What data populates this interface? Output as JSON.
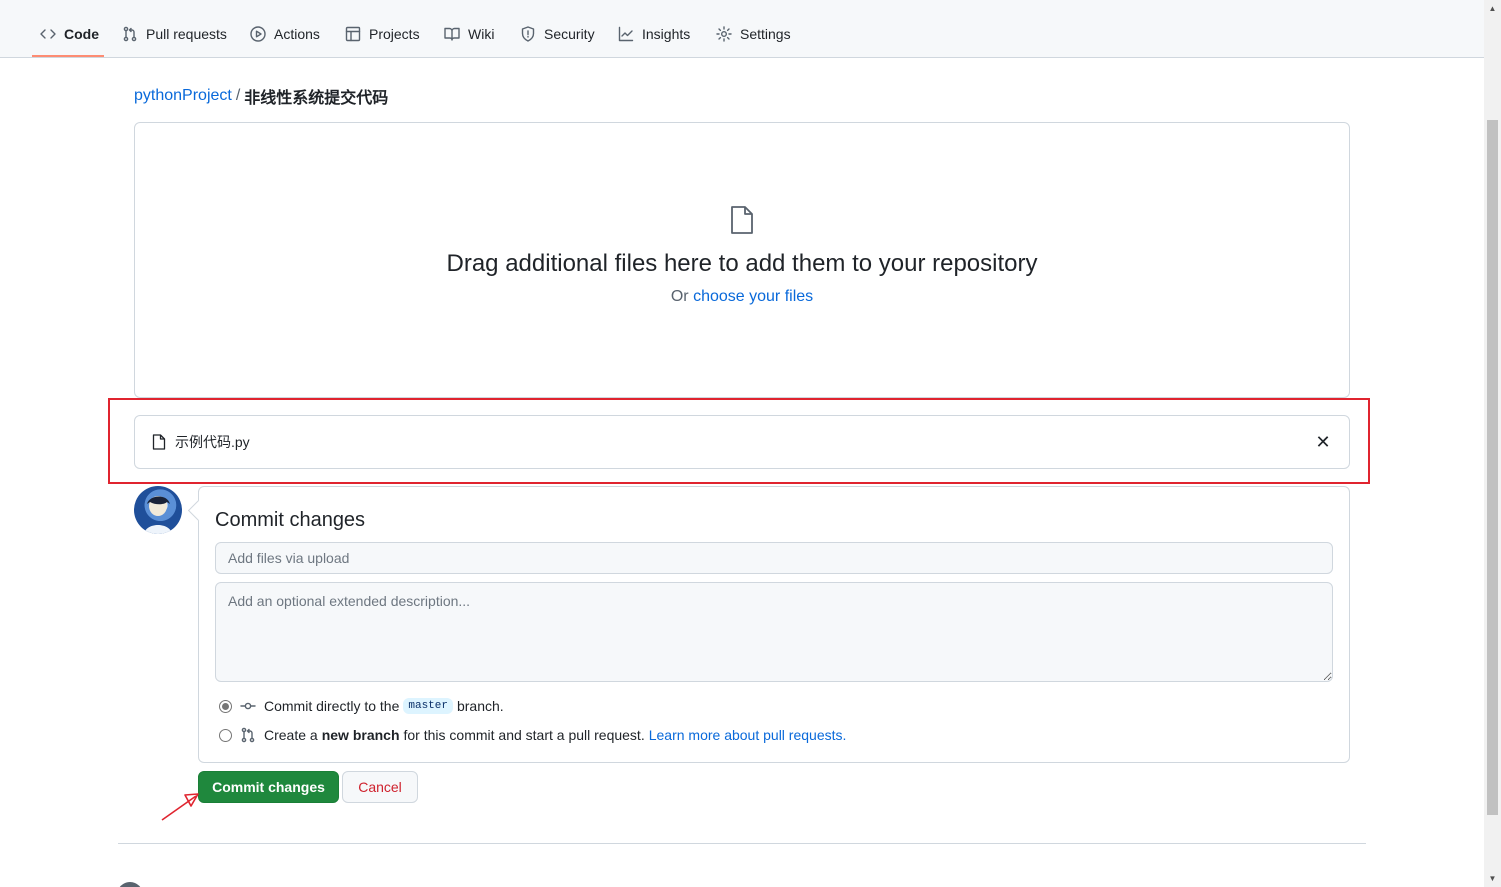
{
  "nav": {
    "items": [
      {
        "label": "Code",
        "icon": "code-icon",
        "active": true
      },
      {
        "label": "Pull requests",
        "icon": "git-pull-request-icon"
      },
      {
        "label": "Actions",
        "icon": "play-icon"
      },
      {
        "label": "Projects",
        "icon": "table-icon"
      },
      {
        "label": "Wiki",
        "icon": "book-icon"
      },
      {
        "label": "Security",
        "icon": "shield-icon"
      },
      {
        "label": "Insights",
        "icon": "graph-icon"
      },
      {
        "label": "Settings",
        "icon": "gear-icon"
      }
    ]
  },
  "breadcrumb": {
    "repo": "pythonProject",
    "separator": "/",
    "folder": "非线性系统提交代码"
  },
  "dropzone": {
    "title": "Drag additional files here to add them to your repository",
    "prefix": "Or",
    "link": "choose your files"
  },
  "file": {
    "name": "示例代码.py",
    "remove_symbol": "✕"
  },
  "commit": {
    "title": "Commit changes",
    "summary_placeholder": "Add files via upload",
    "description_placeholder": "Add an optional extended description...",
    "option_direct": {
      "before": "Commit directly to the",
      "branch": "master",
      "after": "branch.",
      "checked": true
    },
    "option_new_branch": {
      "before": "Create a",
      "bold": "new branch",
      "after": "for this commit and start a pull request.",
      "link": "Learn more about pull requests.",
      "checked": false
    },
    "submit_label": "Commit changes",
    "cancel_label": "Cancel"
  },
  "colors": {
    "accent": "#0969da",
    "primary_button": "#1f883d",
    "danger": "#cf222e",
    "highlight": "#e0242f"
  }
}
